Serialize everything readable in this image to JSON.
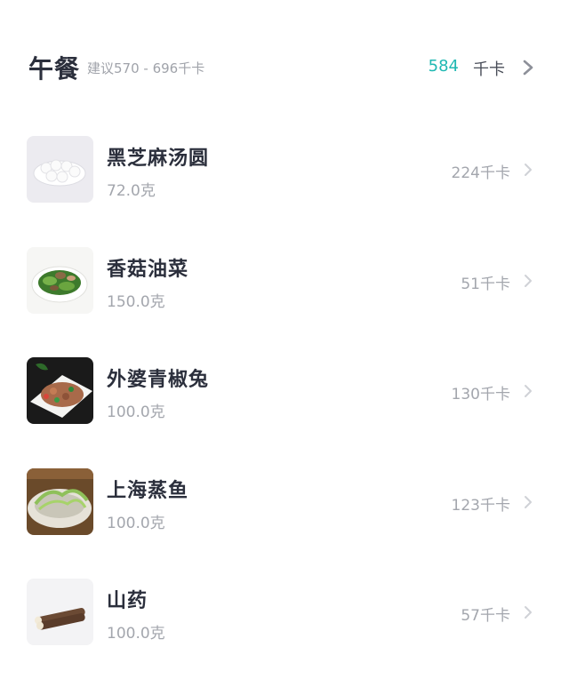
{
  "meal": {
    "title": "午餐",
    "suggestion": "建议570 - 696千卡",
    "kcal_value": "584",
    "kcal_unit": "千卡",
    "accent_color": "#1fb8b2"
  },
  "icons": {
    "chevron": "chevron-right-icon"
  },
  "foods": [
    {
      "name": "黑芝麻汤圆",
      "weight": "72.0克",
      "kcal": "224千卡",
      "image": "black-sesame-tangyuan-image"
    },
    {
      "name": "香菇油菜",
      "weight": "150.0克",
      "kcal": "51千卡",
      "image": "mushroom-greens-image"
    },
    {
      "name": "外婆青椒兔",
      "weight": "100.0克",
      "kcal": "130千卡",
      "image": "pepper-rabbit-image"
    },
    {
      "name": "上海蒸鱼",
      "weight": "100.0克",
      "kcal": "123千卡",
      "image": "steamed-fish-image"
    },
    {
      "name": "山药",
      "weight": "100.0克",
      "kcal": "57千卡",
      "image": "yam-image"
    }
  ]
}
